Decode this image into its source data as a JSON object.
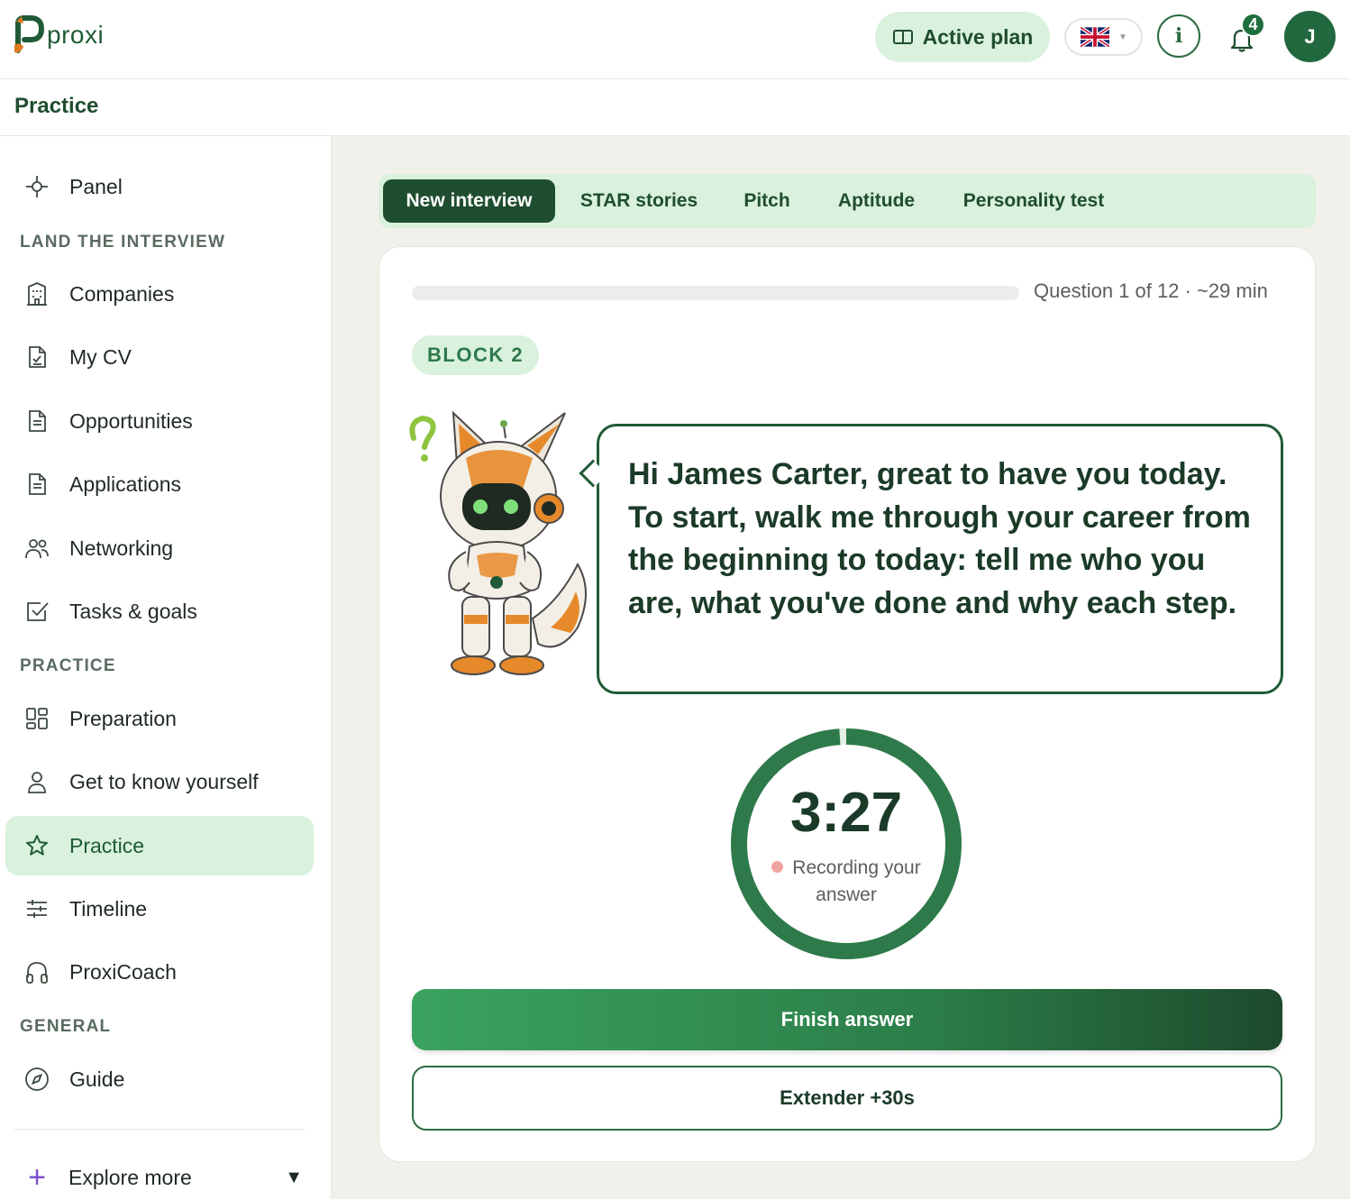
{
  "brand": {
    "name": "proxi",
    "accent": "#1f5b36",
    "accent_light": "#d9f1dd"
  },
  "header": {
    "plan_label": "Active plan",
    "plan_icon": "book-open-icon",
    "language_flag": "uk-flag-icon",
    "info_label": "i",
    "notifications_count": "4",
    "avatar_initial": "J"
  },
  "page_title": "Practice",
  "sidebar": {
    "panel": {
      "label": "Panel",
      "icon": "crosshair-icon"
    },
    "sections": [
      {
        "label": "LAND THE INTERVIEW"
      },
      {
        "label": "PRACTICE"
      },
      {
        "label": "GENERAL"
      }
    ],
    "items": [
      {
        "label": "Companies",
        "icon": "building-icon"
      },
      {
        "label": "My CV",
        "icon": "cv-document-icon"
      },
      {
        "label": "Opportunities",
        "icon": "document-icon"
      },
      {
        "label": "Applications",
        "icon": "document-icon"
      },
      {
        "label": "Networking",
        "icon": "people-icon"
      },
      {
        "label": "Tasks & goals",
        "icon": "checkbox-icon"
      },
      {
        "label": "Preparation",
        "icon": "grid-icon"
      },
      {
        "label": "Get to know yourself",
        "icon": "person-icon"
      },
      {
        "label": "Practice",
        "icon": "star-icon",
        "active": true
      },
      {
        "label": "Timeline",
        "icon": "sliders-icon"
      },
      {
        "label": "ProxiCoach",
        "icon": "headphones-icon"
      },
      {
        "label": "Guide",
        "icon": "compass-icon"
      }
    ],
    "explore_more": "Explore more"
  },
  "tabs": [
    {
      "label": "New interview",
      "active": true
    },
    {
      "label": "STAR stories"
    },
    {
      "label": "Pitch"
    },
    {
      "label": "Aptitude"
    },
    {
      "label": "Personality test"
    }
  ],
  "interview": {
    "progress_fraction": 0.0,
    "question_meta": "Question 1 of 12 · ~29 min",
    "block_label": "BLOCK 2",
    "question_text": "Hi James Carter, great to have you today. To start, walk me through your career from the beginning to today: tell me who you are, what you've done and why each step.",
    "timer": {
      "value": "3:27",
      "remaining_fraction": 0.99,
      "status": "Recording your answer"
    },
    "finish_label": "Finish answer",
    "extend_label": "Extender +30s"
  }
}
